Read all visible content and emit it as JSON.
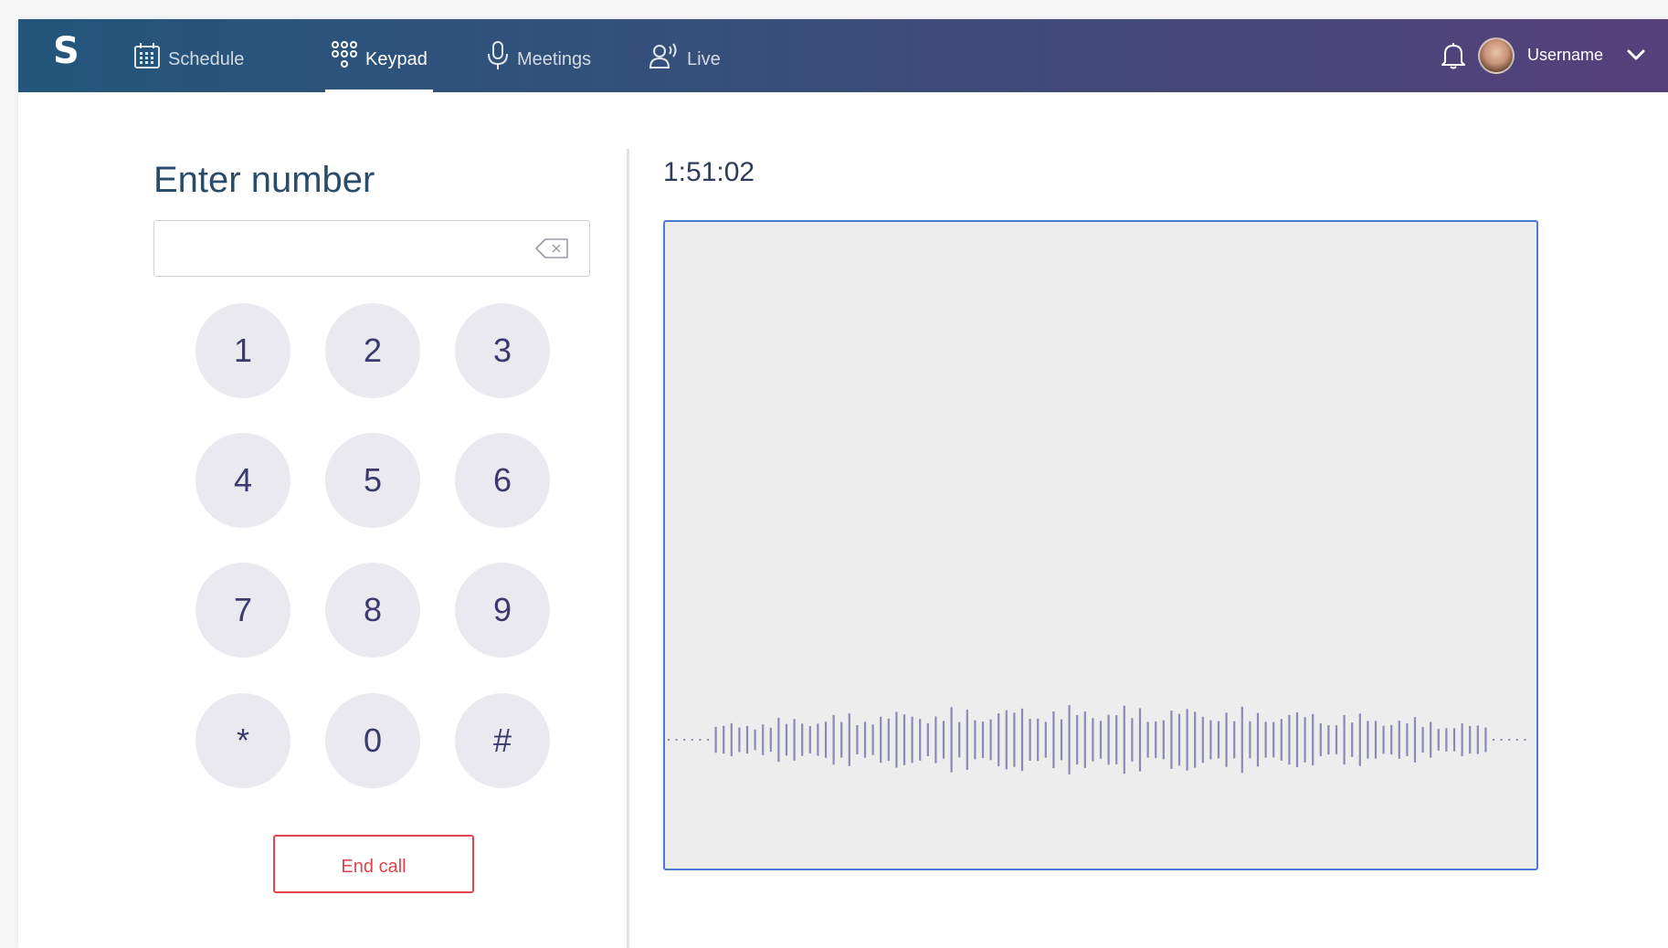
{
  "app": {
    "logo": "S"
  },
  "nav": {
    "items": [
      {
        "label": "Schedule",
        "icon": "calendar-icon",
        "active": false
      },
      {
        "label": "Keypad",
        "icon": "keypad-icon",
        "active": true
      },
      {
        "label": "Meetings",
        "icon": "microphone-icon",
        "active": false
      },
      {
        "label": "Live",
        "icon": "live-broadcast-icon",
        "active": false
      }
    ]
  },
  "user": {
    "name": "Username",
    "notification_icon": "bell-icon",
    "menu_icon": "chevron-down-icon"
  },
  "keypad": {
    "title": "Enter number",
    "number_value": "",
    "number_placeholder": "",
    "backspace_icon": "backspace-icon",
    "keys": [
      "1",
      "2",
      "3",
      "4",
      "5",
      "6",
      "7",
      "8",
      "9",
      "*",
      "0",
      "#"
    ],
    "end_call_label": "End call"
  },
  "call": {
    "timer": "1:51:02",
    "waveform_color": "#8a8ab4",
    "panel_border_color": "#4a7bd0"
  },
  "colors": {
    "nav_start": "#23567c",
    "nav_end": "#55407a",
    "key_background": "#e9e9ef",
    "key_text": "#3a3a6e",
    "end_call": "#e2444d",
    "title": "#2b4b6b"
  }
}
